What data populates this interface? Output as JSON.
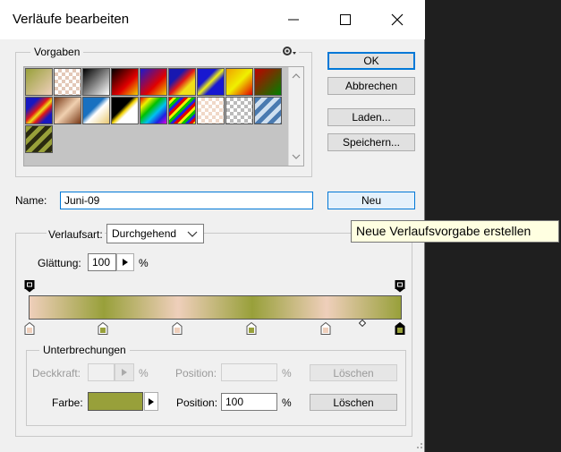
{
  "window": {
    "title": "Verläufe bearbeiten"
  },
  "presets": {
    "label": "Vorgaben",
    "menu_icon": "gear-icon"
  },
  "buttons": {
    "ok": "OK",
    "cancel": "Abbrechen",
    "load": "Laden...",
    "save": "Speichern...",
    "new": "Neu"
  },
  "name": {
    "label": "Name:",
    "value": "Juni-09"
  },
  "tooltip": "Neue Verlaufsvorgabe erstellen",
  "gradient": {
    "type_label": "Verlaufsart:",
    "type_value": "Durchgehend",
    "smoothness_label": "Glättung:",
    "smoothness_value": "100",
    "smoothness_unit": "%"
  },
  "stops": {
    "label": "Unterbrechungen",
    "opacity_label": "Deckkraft:",
    "opacity_unit": "%",
    "opacity_position_label": "Position:",
    "opacity_position_unit": "%",
    "opacity_delete": "Löschen",
    "color_label": "Farbe:",
    "color_value": "#98a03a",
    "color_position_label": "Position:",
    "color_position_value": "100",
    "color_position_unit": "%",
    "color_delete": "Löschen"
  }
}
